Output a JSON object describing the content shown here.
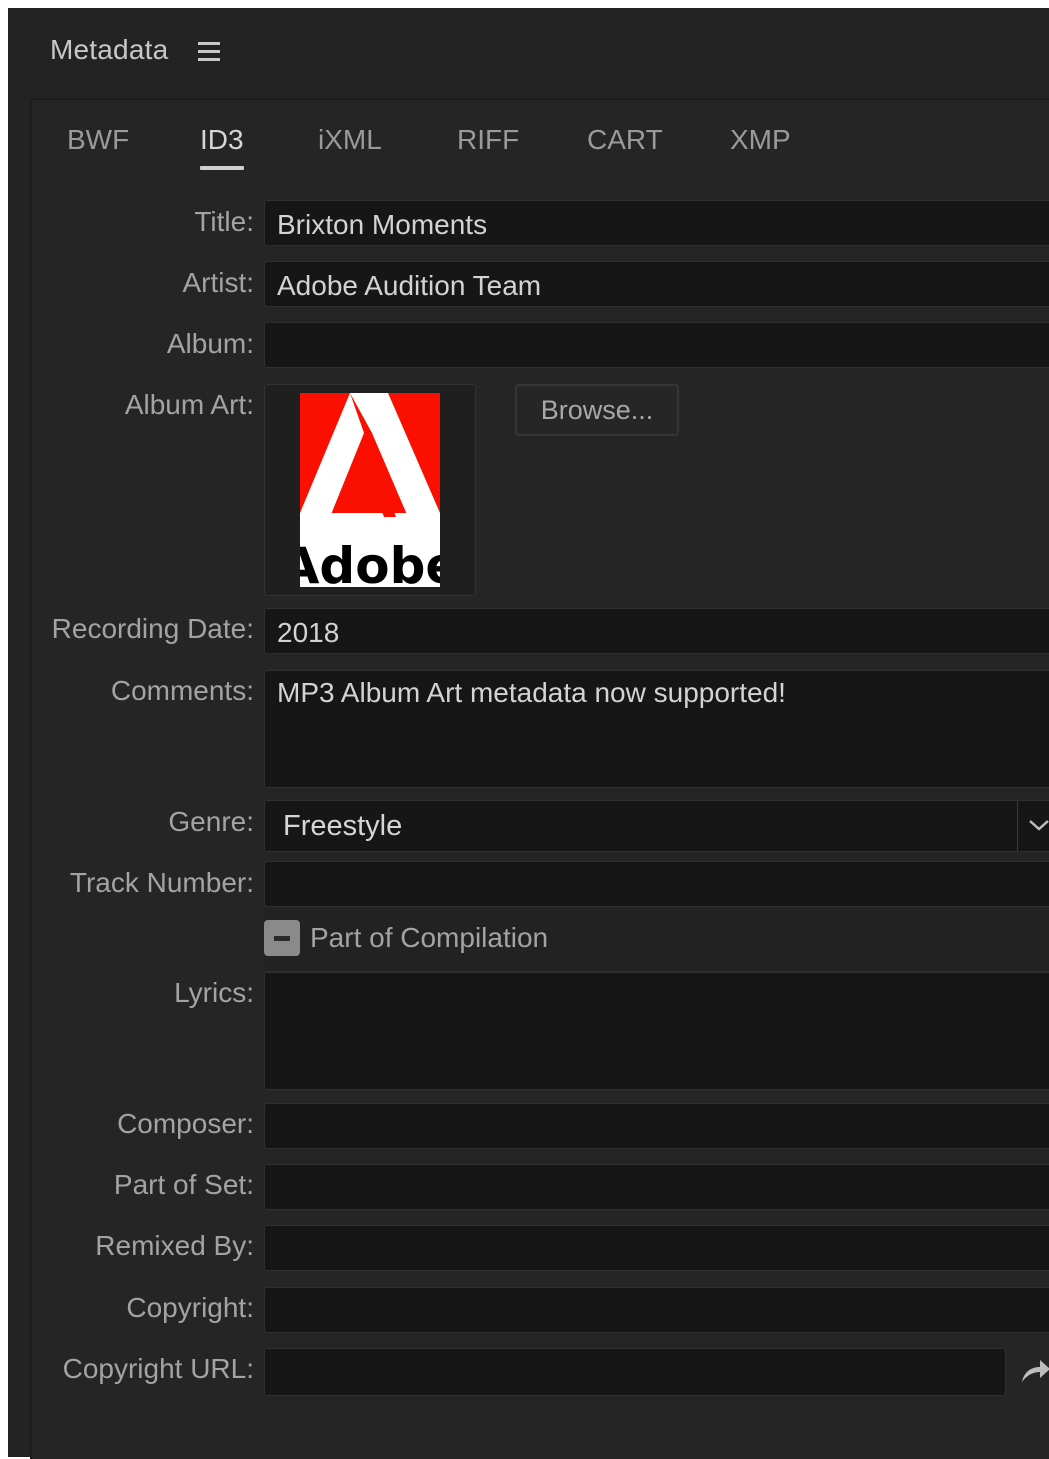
{
  "panel": {
    "title": "Metadata",
    "menu_icon": "hamburger-menu-icon"
  },
  "tabs": [
    {
      "label": "BWF",
      "active": false
    },
    {
      "label": "ID3",
      "active": true
    },
    {
      "label": "iXML",
      "active": false
    },
    {
      "label": "RIFF",
      "active": false
    },
    {
      "label": "CART",
      "active": false
    },
    {
      "label": "XMP",
      "active": false
    }
  ],
  "fields": {
    "title": {
      "label": "Title:",
      "value": "Brixton Moments"
    },
    "artist": {
      "label": "Artist:",
      "value": "Adobe Audition Team"
    },
    "album": {
      "label": "Album:",
      "value": ""
    },
    "album_art": {
      "label": "Album Art:",
      "browse_label": "Browse...",
      "logo_text": "Adobe"
    },
    "recording_date": {
      "label": "Recording Date:",
      "value": "2018"
    },
    "comments": {
      "label": "Comments:",
      "value": "MP3 Album Art metadata now supported!"
    },
    "genre": {
      "label": "Genre:",
      "value": "Freestyle"
    },
    "track_number": {
      "label": "Track Number:",
      "value": ""
    },
    "compilation": {
      "label": "Part of Compilation",
      "state": "indeterminate"
    },
    "lyrics": {
      "label": "Lyrics:",
      "value": ""
    },
    "composer": {
      "label": "Composer:",
      "value": ""
    },
    "part_of_set": {
      "label": "Part of Set:",
      "value": ""
    },
    "remixed_by": {
      "label": "Remixed By:",
      "value": ""
    },
    "copyright": {
      "label": "Copyright:",
      "value": ""
    },
    "copyright_url": {
      "label": "Copyright URL:",
      "value": ""
    }
  },
  "colors": {
    "background": "#232323",
    "field_bg": "#161616",
    "text": "#d3d3d3",
    "label": "#a3a3a3",
    "adobe_red": "#fa0f00"
  }
}
